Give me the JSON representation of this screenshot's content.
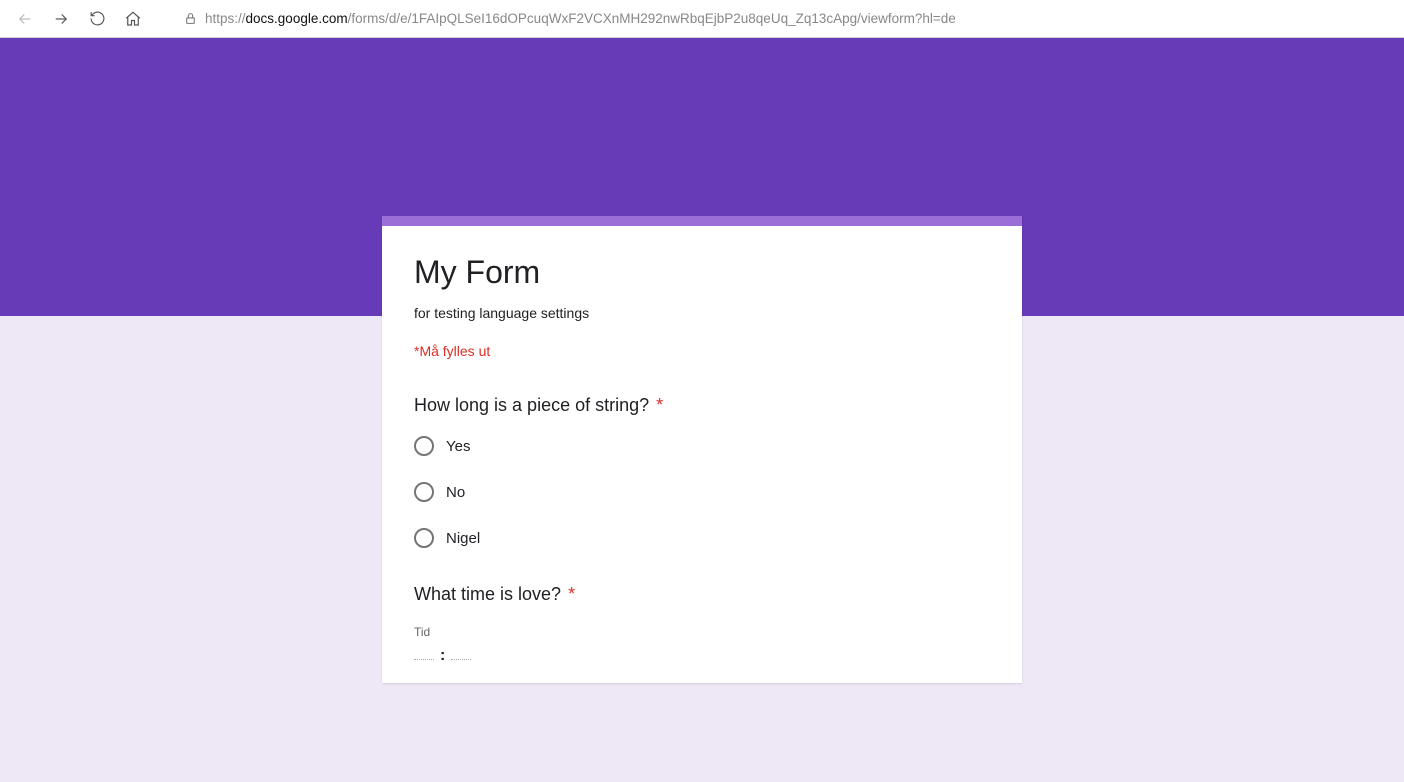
{
  "browser": {
    "url_prefix": "https://",
    "url_host": "docs.google.com",
    "url_path": "/forms/d/e/1FAIpQLSeI16dOPcuqWxF2VCXnMH292nwRbqEjbP2u8qeUq_Zq13cApg/viewform?hl=de"
  },
  "form": {
    "title": "My Form",
    "description": "for testing language settings",
    "required_legend": "*Må fylles ut",
    "questions": [
      {
        "title": "How long is a piece of string?",
        "required": true,
        "options": [
          "Yes",
          "No",
          "Nigel"
        ]
      },
      {
        "title": "What time is love?",
        "required": true,
        "time_label": "Tid",
        "time_separator": ":"
      }
    ],
    "required_mark": "*"
  },
  "colors": {
    "banner": "#673ab7",
    "accent": "#9b6dd6",
    "page_bg": "#ede7f6",
    "error": "#d93025"
  }
}
